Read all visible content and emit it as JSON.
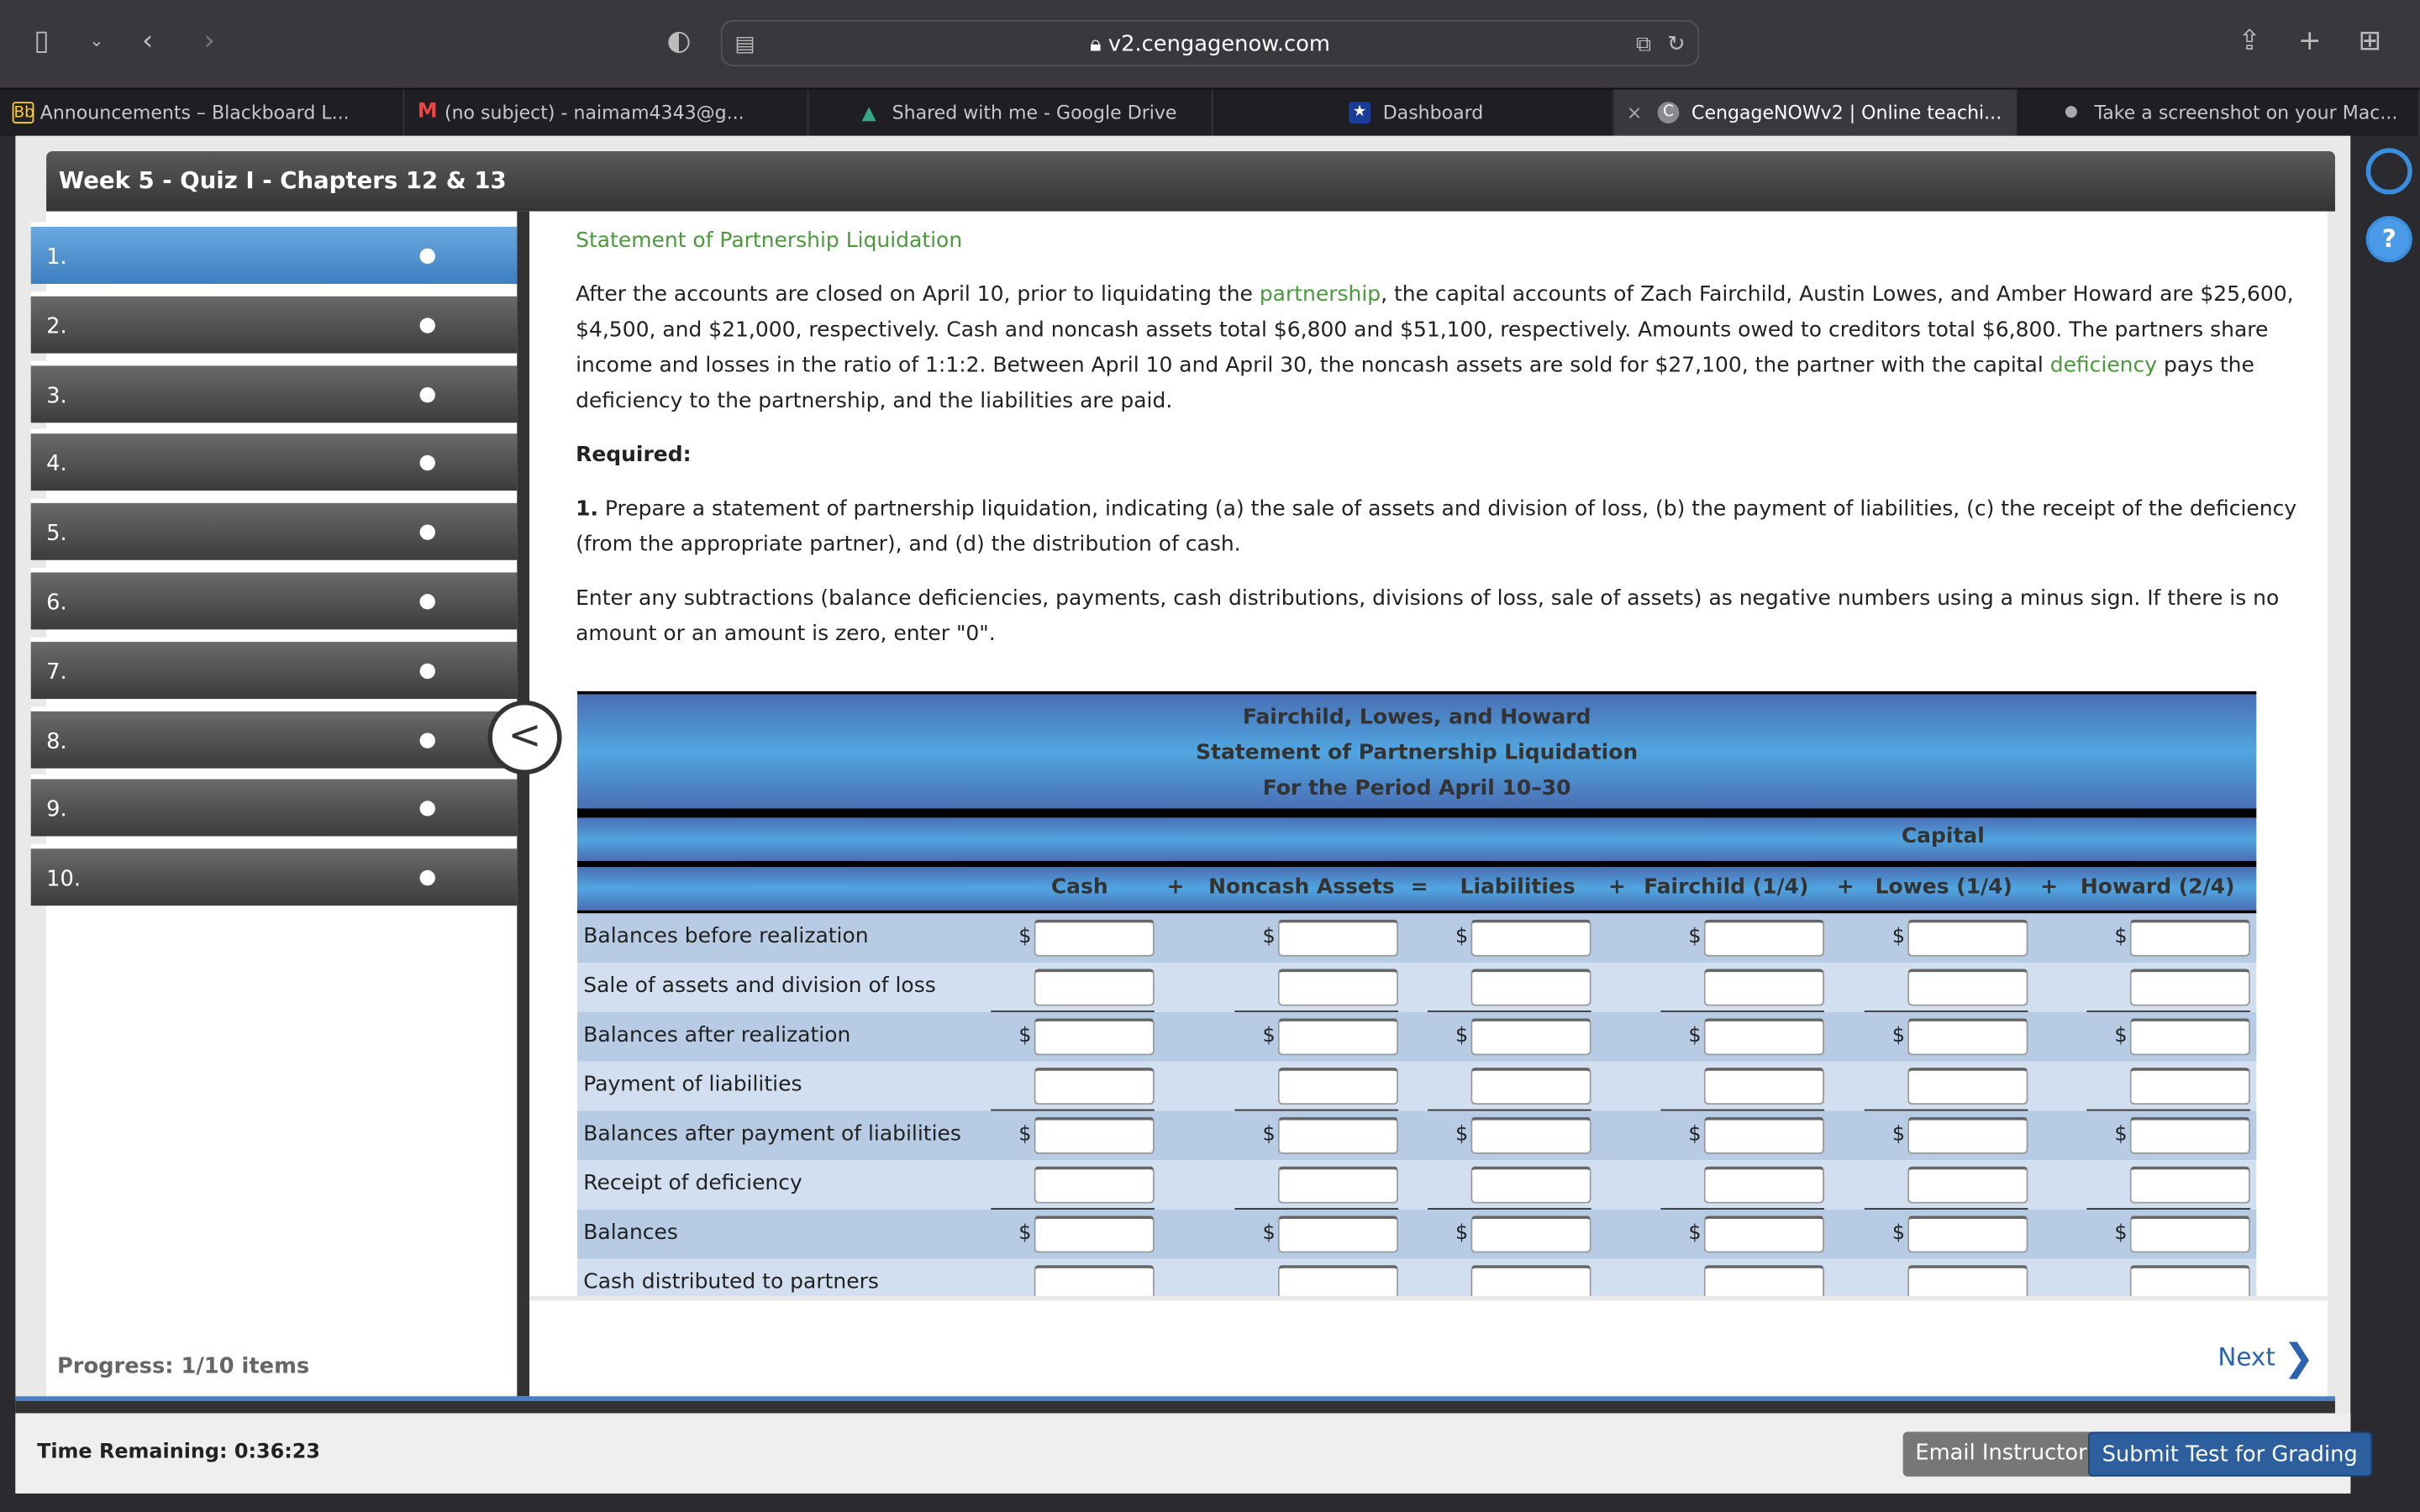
{
  "browser": {
    "url": "v2.cengagenow.com",
    "tabs": [
      {
        "label": "Announcements – Blackboard L...",
        "icon": "blackboard-icon"
      },
      {
        "label": "(no subject) - naimam4343@g...",
        "icon": "gmail-icon"
      },
      {
        "label": "Shared with me - Google Drive",
        "icon": "google-drive-icon"
      },
      {
        "label": "Dashboard",
        "icon": "star-icon"
      },
      {
        "label": "CengageNOWv2 | Online teachi...",
        "icon": "cengage-icon",
        "active": true
      },
      {
        "label": "Take a screenshot on your Mac...",
        "icon": "apple-icon"
      }
    ]
  },
  "quiz": {
    "title": "Week 5 - Quiz I - Chapters 12 & 13",
    "items": [
      "1.",
      "2.",
      "3.",
      "4.",
      "5.",
      "6.",
      "7.",
      "8.",
      "9.",
      "10."
    ],
    "active_item": 1,
    "progress": "Progress:  1/10 items",
    "time_remaining": "Time Remaining: 0:36:23"
  },
  "question": {
    "heading": "Statement of Partnership Liquidation",
    "p1_a": "After the accounts are closed on April 10, prior to liquidating the ",
    "p1_link1": "partnership",
    "p1_b": ", the capital accounts of Zach Fairchild, Austin Lowes, and Amber Howard are $25,600, $4,500, and $21,000, respectively. Cash and noncash assets total $6,800 and $51,100, respectively. Amounts owed to creditors total $6,800. The partners share income and losses in the ratio of 1:1:2. Between April 10 and April 30, the noncash assets are sold for $27,100, the partner with the capital ",
    "p1_link2": "deficiency",
    "p1_c": " pays the deficiency to the partnership, and the liabilities are paid.",
    "required": "Required:",
    "req1_num": "1.",
    "req1": " Prepare a statement of partnership liquidation, indicating (a) the sale of assets and division of loss, (b) the payment of liabilities, (c) the receipt of the deficiency (from the appropriate partner), and (d) the distribution of cash.",
    "instructions": "Enter any subtractions (balance deficiencies, payments, cash distributions, divisions of loss, sale of assets) as negative numbers using a minus sign. If there is no amount or an amount is zero, enter \"0\"."
  },
  "statement": {
    "title1": "Fairchild, Lowes, and Howard",
    "title2": "Statement of Partnership Liquidation",
    "title3": "For the Period April 10–30",
    "capital": "Capital",
    "columns": [
      "Cash",
      "Noncash Assets",
      "Liabilities",
      "Fairchild (1/4)",
      "Lowes (1/4)",
      "Howard (2/4)"
    ],
    "operators": [
      "+",
      "=",
      "+",
      "+",
      "+"
    ],
    "currency": "$",
    "rows": [
      {
        "label": "Balances before realization",
        "dollar": true
      },
      {
        "label": "Sale of assets and division of loss",
        "dollar": false,
        "underline": true
      },
      {
        "label": "Balances after realization",
        "dollar": true
      },
      {
        "label": "Payment of liabilities",
        "dollar": false,
        "underline": true
      },
      {
        "label": "Balances after payment of liabilities",
        "dollar": true
      },
      {
        "label": "Receipt of deficiency",
        "dollar": false,
        "underline": true
      },
      {
        "label": "Balances",
        "dollar": true
      },
      {
        "label": "Cash distributed to partners",
        "dollar": false
      }
    ]
  },
  "nav": {
    "next": "Next",
    "email": "Email Instructor",
    "submit": "Submit Test for Grading"
  },
  "colors": {
    "accent": "#2a64b0",
    "link": "#4a9a3c",
    "submit": "#2d5f9e"
  }
}
